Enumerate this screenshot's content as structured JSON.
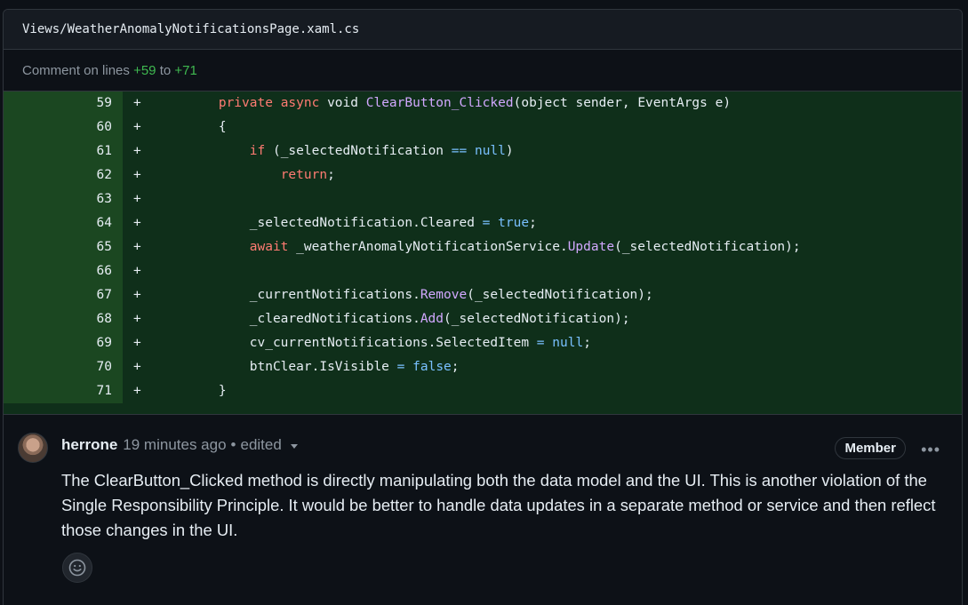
{
  "file": {
    "path": "Views/WeatherAnomalyNotificationsPage.xaml.cs"
  },
  "comment_range": {
    "prefix": "Comment on lines",
    "start": "+59",
    "to": "to",
    "end": "+71"
  },
  "diff": {
    "marker": "+",
    "lines": [
      {
        "num": "59",
        "code": "        private async void ClearButton_Clicked(object sender, EventArgs e)"
      },
      {
        "num": "60",
        "code": "        {"
      },
      {
        "num": "61",
        "code": "            if (_selectedNotification == null)"
      },
      {
        "num": "62",
        "code": "                return;"
      },
      {
        "num": "63",
        "code": ""
      },
      {
        "num": "64",
        "code": "            _selectedNotification.Cleared = true;"
      },
      {
        "num": "65",
        "code": "            await _weatherAnomalyNotificationService.Update(_selectedNotification);"
      },
      {
        "num": "66",
        "code": ""
      },
      {
        "num": "67",
        "code": "            _currentNotifications.Remove(_selectedNotification);"
      },
      {
        "num": "68",
        "code": "            _clearedNotifications.Add(_selectedNotification);"
      },
      {
        "num": "69",
        "code": "            cv_currentNotifications.SelectedItem = null;"
      },
      {
        "num": "70",
        "code": "            btnClear.IsVisible = false;"
      },
      {
        "num": "71",
        "code": "        }"
      }
    ]
  },
  "comment": {
    "author": "herrone",
    "time": "19 minutes ago",
    "separator": "•",
    "edited": "edited",
    "badge": "Member",
    "menu": "•••",
    "body": "The ClearButton_Clicked method is directly manipulating both the data model and the UI. This is another violation of the Single Responsibility Principle. It would be better to handle data updates in a separate method or service and then reflect those changes in the UI."
  },
  "colors": {
    "background": "#0d1117",
    "added_line_number_bg": "#1b4721",
    "added_code_bg": "#0f2f1a",
    "keyword": "#ff7b72",
    "function": "#d2a8ff",
    "constant": "#79c0ff",
    "plus_green": "#3fb950"
  }
}
